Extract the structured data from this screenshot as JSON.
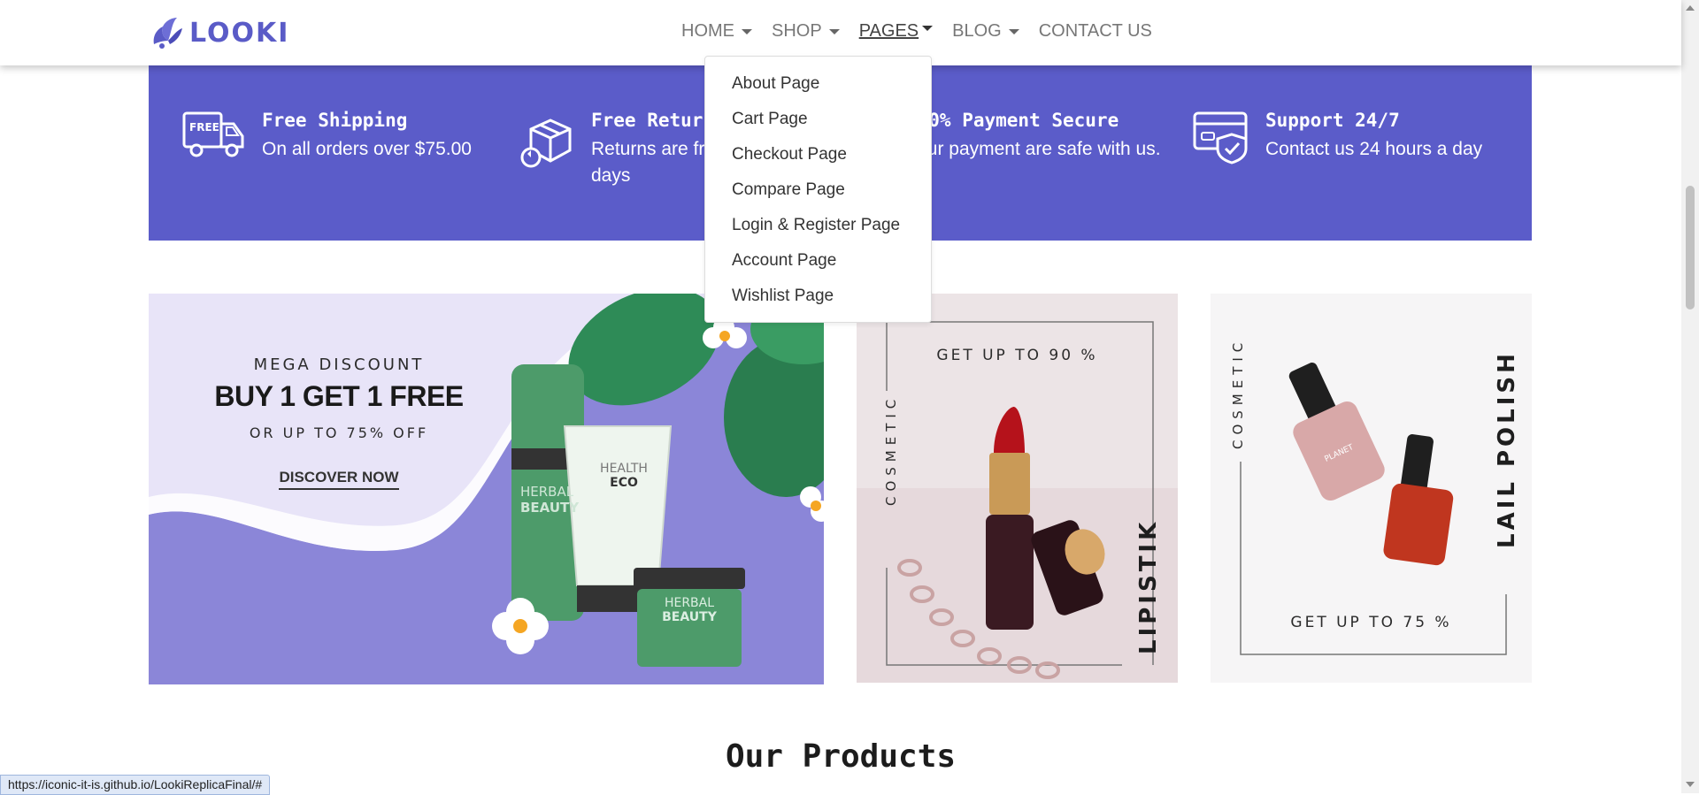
{
  "brand": {
    "name": "LOOKI",
    "color": "#5a5bc7"
  },
  "nav": {
    "items": [
      {
        "label": "HOME",
        "has_caret": true
      },
      {
        "label": "SHOP",
        "has_caret": true
      },
      {
        "label": "PAGES",
        "has_caret": true,
        "active": true
      },
      {
        "label": "BLOG",
        "has_caret": true
      },
      {
        "label": "CONTACT US",
        "has_caret": false
      }
    ]
  },
  "pages_menu": {
    "items": [
      "About Page",
      "Cart Page",
      "Checkout Page",
      "Compare Page",
      "Login & Register Page",
      "Account Page",
      "Wishlist Page"
    ]
  },
  "features": {
    "background": "#5b5cc9",
    "items": [
      {
        "icon": "delivery-truck-icon",
        "title": "Free Shipping",
        "text": "On all orders over $75.00"
      },
      {
        "icon": "return-box-icon",
        "title": "Free Returns",
        "text": "Returns are free within 9 days"
      },
      {
        "icon": "secure-payment-icon",
        "title": "100% Payment Secure",
        "text": "Your payment are safe with us."
      },
      {
        "icon": "credit-card-shield-icon",
        "title": "Support 24/7",
        "text": "Contact us 24 hours a day"
      }
    ]
  },
  "banners": {
    "mega": {
      "kicker": "MEGA DISCOUNT",
      "headline": "BUY 1 GET 1 FREE",
      "subline": "OR UP TO 75% OFF",
      "cta": "DISCOVER NOW",
      "product_labels": [
        "HERBAL",
        "BEAUTY",
        "HEALTH",
        "ECO",
        "HERBAL",
        "BEAUTY"
      ]
    },
    "lipstick": {
      "offer": "GET UP TO 90 %",
      "category": "COSMETIC",
      "product": "LIPISTIK"
    },
    "nail": {
      "offer": "GET UP TO 75 %",
      "category": "COSMETIC",
      "product": "LAIL POLISH",
      "bottle_text": "PLANET"
    }
  },
  "sections": {
    "products_title": "Our Products"
  },
  "status_bar": {
    "url": "https://iconic-it-is.github.io/LookiReplicaFinal/#"
  }
}
